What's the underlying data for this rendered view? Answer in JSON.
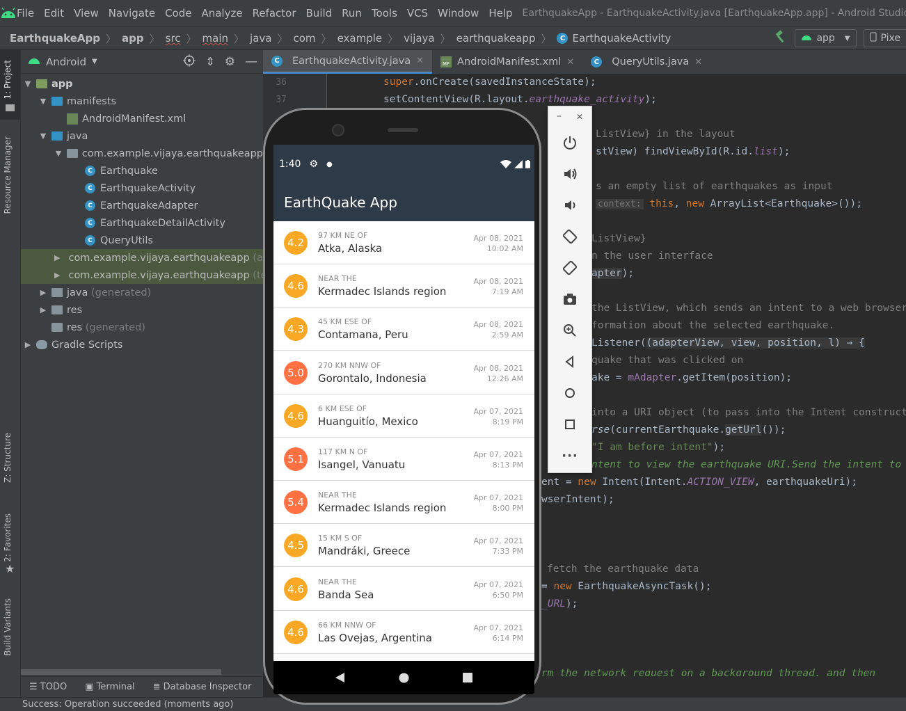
{
  "menubar": {
    "items": [
      "File",
      "Edit",
      "View",
      "Navigate",
      "Code",
      "Analyze",
      "Refactor",
      "Build",
      "Run",
      "Tools",
      "VCS",
      "Window",
      "Help"
    ],
    "window_title": "EarthquakeApp - EarthquakeActivity.java [EarthquakeApp.app] - Android Studio"
  },
  "breadcrumb": {
    "items": [
      "EarthquakeApp",
      "app",
      "src",
      "main",
      "java",
      "com",
      "example",
      "vijaya",
      "earthquakeapp",
      "EarthquakeActivity"
    ],
    "run_config": "app",
    "device": "Pixe"
  },
  "left_strip": {
    "project": "1: Project",
    "resource": "Resource Manager",
    "structure": "Z: Structure",
    "favorites": "2: Favorites",
    "variants": "Build Variants"
  },
  "project": {
    "view_label": "Android",
    "tree": [
      {
        "label": "app",
        "suffix": ""
      },
      {
        "label": "manifests",
        "suffix": ""
      },
      {
        "label": "AndroidManifest.xml",
        "suffix": ""
      },
      {
        "label": "java",
        "suffix": ""
      },
      {
        "label": "com.example.vijaya.earthquakeapp",
        "suffix": ""
      },
      {
        "label": "Earthquake",
        "suffix": ""
      },
      {
        "label": "EarthquakeActivity",
        "suffix": ""
      },
      {
        "label": "EarthquakeAdapter",
        "suffix": ""
      },
      {
        "label": "EarthquakeDetailActivity",
        "suffix": ""
      },
      {
        "label": "QueryUtils",
        "suffix": ""
      },
      {
        "label": "com.example.vijaya.earthquakeapp",
        "suffix": "(ar"
      },
      {
        "label": "com.example.vijaya.earthquakeapp",
        "suffix": "(te"
      },
      {
        "label": "java",
        "suffix": "(generated)"
      },
      {
        "label": "res",
        "suffix": ""
      },
      {
        "label": "res",
        "suffix": "(generated)"
      },
      {
        "label": "Gradle Scripts",
        "suffix": ""
      }
    ]
  },
  "bottom_tools": [
    "TODO",
    "Terminal",
    "Database Inspector"
  ],
  "status": "Success: Operation succeeded (moments ago)",
  "editor": {
    "tabs": [
      {
        "label": "EarthquakeActivity.java",
        "badge": "C"
      },
      {
        "label": "AndroidManifest.xml",
        "badge": "MF"
      },
      {
        "label": "QueryUtils.java",
        "badge": "C"
      }
    ],
    "line_numbers": [
      "36",
      "37"
    ],
    "hint_context": "context:"
  },
  "phone": {
    "time": "1:40",
    "app_title": "EarthQuake App",
    "colors": {
      "mag_low": "#f9a825",
      "mag_mid": "#fb8c00",
      "mag_high": "#ff7043",
      "toolbar": "#2f3a48"
    },
    "quakes": [
      {
        "mag": "4.2",
        "offset": "97 km NE of",
        "place": "Atka, Alaska",
        "date": "Apr 08, 2021",
        "time": "10:02 AM",
        "color": "#f9a825"
      },
      {
        "mag": "4.6",
        "offset": "Near the",
        "place": "Kermadec Islands region",
        "date": "Apr 08, 2021",
        "time": "7:19 AM",
        "color": "#f9a825"
      },
      {
        "mag": "4.3",
        "offset": "45 km ESE of",
        "place": "Contamana, Peru",
        "date": "Apr 08, 2021",
        "time": "2:59 AM",
        "color": "#f9a825"
      },
      {
        "mag": "5.0",
        "offset": "270 km NNW of",
        "place": "Gorontalo, Indonesia",
        "date": "Apr 08, 2021",
        "time": "12:26 AM",
        "color": "#ff7043"
      },
      {
        "mag": "4.6",
        "offset": "6 km ESE of",
        "place": "Huanguitío, Mexico",
        "date": "Apr 07, 2021",
        "time": "8:19 PM",
        "color": "#f9a825"
      },
      {
        "mag": "5.1",
        "offset": "117 km N of",
        "place": "Isangel, Vanuatu",
        "date": "Apr 07, 2021",
        "time": "8:13 PM",
        "color": "#ff7043"
      },
      {
        "mag": "5.4",
        "offset": "Near the",
        "place": "Kermadec Islands region",
        "date": "Apr 07, 2021",
        "time": "8:00 PM",
        "color": "#ff7043"
      },
      {
        "mag": "4.5",
        "offset": "15 km S of",
        "place": "Mandráki, Greece",
        "date": "Apr 07, 2021",
        "time": "7:33 PM",
        "color": "#f9a825"
      },
      {
        "mag": "4.6",
        "offset": "Near the",
        "place": "Banda Sea",
        "date": "Apr 07, 2021",
        "time": "6:50 PM",
        "color": "#f9a825"
      },
      {
        "mag": "4.6",
        "offset": "66 km NNW of",
        "place": "Las Ovejas, Argentina",
        "date": "Apr 07, 2021",
        "time": "6:14 PM",
        "color": "#f9a825"
      }
    ]
  }
}
